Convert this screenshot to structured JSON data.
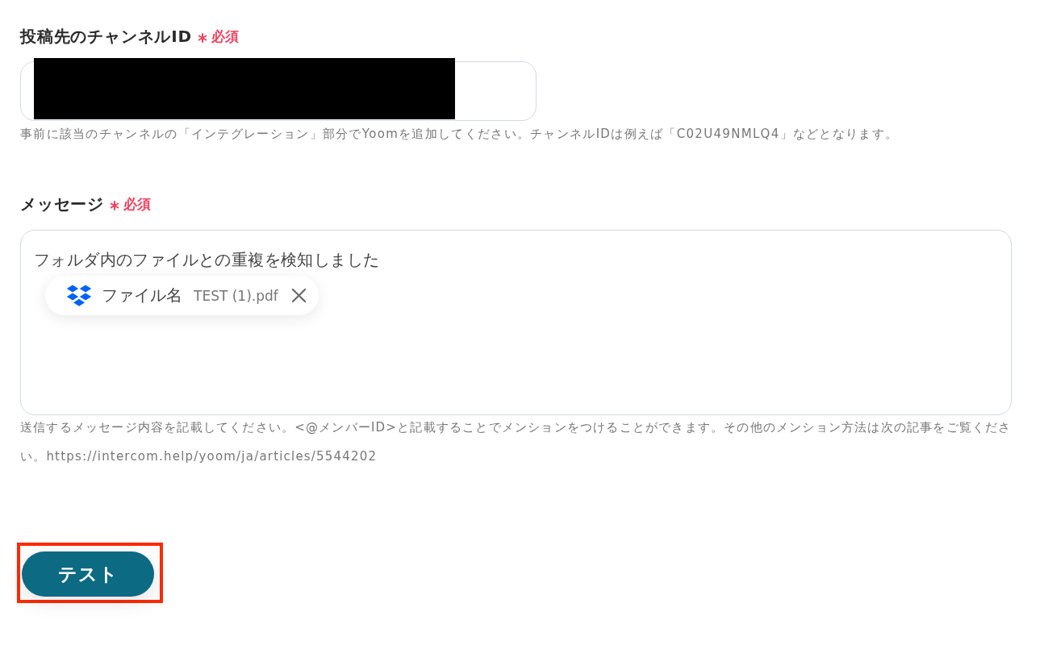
{
  "fields": [
    {
      "kind": "text_input",
      "label": "投稿先のチャンネルID",
      "required": true,
      "required_label": "必須",
      "redacted": true,
      "hint": "事前に該当のチャンネルの「インテグレーション」部分でYoomを追加してください。チャンネルIDは例えば「C02U49NMLQ4」などとなります。"
    },
    {
      "kind": "textarea",
      "label": "メッセージ",
      "required": true,
      "required_label": "必須",
      "value": "フォルダ内のファイルとの重複を検知しました",
      "tokens": [
        {
          "label": "ファイル名",
          "value": "TEST (1).pdf"
        }
      ],
      "hint": "送信するメッセージ内容を記載してください。<@メンバーID>と記載することでメンションをつけることができます。その他のメンション方法は次の記事をご覧ください。https://intercom.help/yoom/ja/articles/5544202"
    }
  ],
  "button": {
    "label": "テスト",
    "highlighted": true
  }
}
